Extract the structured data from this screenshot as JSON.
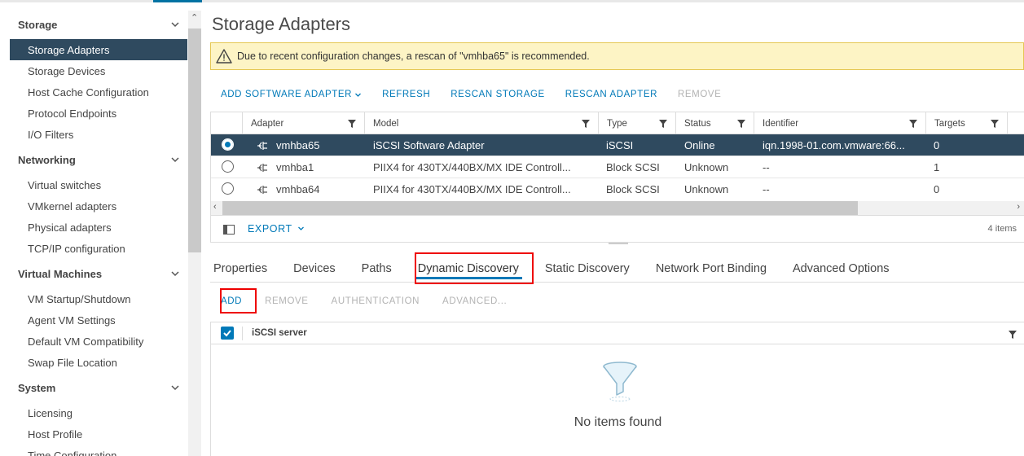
{
  "sidebar": {
    "sections": [
      {
        "title": "Storage",
        "items": [
          "Storage Adapters",
          "Storage Devices",
          "Host Cache Configuration",
          "Protocol Endpoints",
          "I/O Filters"
        ]
      },
      {
        "title": "Networking",
        "items": [
          "Virtual switches",
          "VMkernel adapters",
          "Physical adapters",
          "TCP/IP configuration"
        ]
      },
      {
        "title": "Virtual Machines",
        "items": [
          "VM Startup/Shutdown",
          "Agent VM Settings",
          "Default VM Compatibility",
          "Swap File Location"
        ]
      },
      {
        "title": "System",
        "items": [
          "Licensing",
          "Host Profile",
          "Time Configuration"
        ]
      }
    ],
    "active_item": "Storage Adapters"
  },
  "page": {
    "title": "Storage Adapters",
    "alert": "Due to recent configuration changes, a rescan of \"vmhba65\" is recommended."
  },
  "toolbar": {
    "add_software_adapter": "ADD SOFTWARE ADAPTER",
    "refresh": "REFRESH",
    "rescan_storage": "RESCAN STORAGE",
    "rescan_adapter": "RESCAN ADAPTER",
    "remove": "REMOVE"
  },
  "adapters_grid": {
    "columns": [
      "Adapter",
      "Model",
      "Type",
      "Status",
      "Identifier",
      "Targets"
    ],
    "rows": [
      {
        "adapter": "vmhba65",
        "model": "iSCSI Software Adapter",
        "type": "iSCSI",
        "status": "Online",
        "identifier": "iqn.1998-01.com.vmware:66...",
        "targets": "0",
        "selected": true
      },
      {
        "adapter": "vmhba1",
        "model": "PIIX4 for 430TX/440BX/MX IDE Controll...",
        "type": "Block SCSI",
        "status": "Unknown",
        "identifier": "--",
        "targets": "1",
        "selected": false
      },
      {
        "adapter": "vmhba64",
        "model": "PIIX4 for 430TX/440BX/MX IDE Controll...",
        "type": "Block SCSI",
        "status": "Unknown",
        "identifier": "--",
        "targets": "0",
        "selected": false
      }
    ],
    "export_label": "EXPORT",
    "item_count": "4 items"
  },
  "tabs": [
    "Properties",
    "Devices",
    "Paths",
    "Dynamic Discovery",
    "Static Discovery",
    "Network Port Binding",
    "Advanced Options"
  ],
  "active_tab": "Dynamic Discovery",
  "discovery_toolbar": {
    "add": "ADD",
    "remove": "REMOVE",
    "authentication": "AUTHENTICATION",
    "advanced": "ADVANCED..."
  },
  "discovery_grid": {
    "column": "iSCSI server",
    "empty_text": "No items found"
  },
  "colors": {
    "accent": "#0079b8",
    "selected_row": "#2f4a5f",
    "alert_bg": "#fdf4c5",
    "highlight": "#e00000"
  }
}
